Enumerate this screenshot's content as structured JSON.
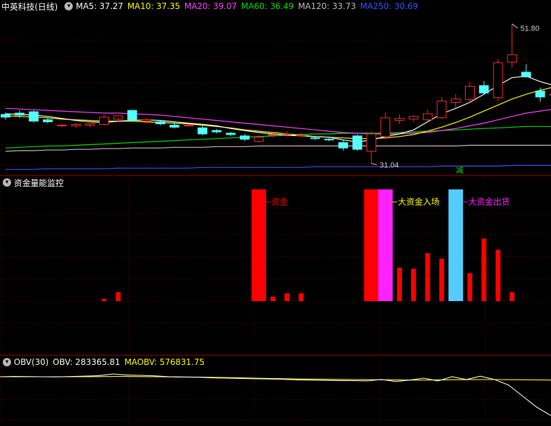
{
  "colors": {
    "up": "#ff2b2b",
    "down": "#54ffff",
    "grid": "#7a0000",
    "ma5": "#ffffff",
    "ma10": "#ffff00",
    "ma20": "#ff44ff",
    "ma60": "#00e000",
    "ma120": "#bfbfbf",
    "ma250": "#3355ff",
    "fund_red": "#ff0000",
    "fund_magenta": "#ff22ff",
    "fund_blue": "#55ccff",
    "obv": "#ffffff",
    "maobv": "#ffff00",
    "jian": "#00e000"
  },
  "main_panel": {
    "title": "中英科技(日线)",
    "indicators": [
      {
        "label": "MA5: 37.27",
        "color": "#ffffff"
      },
      {
        "label": "MA10: 37.35",
        "color": "#ffff00"
      },
      {
        "label": "MA20: 39.07",
        "color": "#ff44ff"
      },
      {
        "label": "MA60: 36.49",
        "color": "#00e000"
      },
      {
        "label": "MA120: 33.73",
        "color": "#bfbfbf"
      },
      {
        "label": "MA250: 30.69",
        "color": "#3355ff"
      }
    ],
    "high_label": "51.80",
    "low_label": "31.04",
    "marker_text": "减"
  },
  "fund_panel": {
    "title": "资金量能监控",
    "labels": [
      {
        "text": "资金",
        "color": "#ff0000"
      },
      {
        "text": "大资金入场",
        "color": "#ffff00"
      },
      {
        "text": "大资金出货",
        "color": "#ff22ff"
      }
    ]
  },
  "obv_panel": {
    "title": "OBV(30)",
    "obv_label": "OBV: 283365.81",
    "maobv_label": "MAOBV: 576831.75"
  },
  "chart_data": [
    {
      "type": "candlestick",
      "name": "中英科技(日线)",
      "price_range": [
        29.5,
        53.5
      ],
      "candles": [
        {
          "o": 38.3,
          "h": 38.6,
          "l": 37.5,
          "c": 37.9
        },
        {
          "o": 38.5,
          "h": 38.9,
          "l": 37.8,
          "c": 38.2
        },
        {
          "o": 38.7,
          "h": 38.9,
          "l": 37.1,
          "c": 37.3
        },
        {
          "o": 37.5,
          "h": 37.8,
          "l": 37.0,
          "c": 37.2
        },
        {
          "o": 36.6,
          "h": 36.9,
          "l": 36.4,
          "c": 36.7
        },
        {
          "o": 36.6,
          "h": 37.0,
          "l": 36.3,
          "c": 36.8
        },
        {
          "o": 36.7,
          "h": 37.0,
          "l": 36.4,
          "c": 36.9
        },
        {
          "o": 36.8,
          "h": 38.3,
          "l": 36.7,
          "c": 37.9
        },
        {
          "o": 37.6,
          "h": 38.0,
          "l": 37.2,
          "c": 38.1
        },
        {
          "o": 38.9,
          "h": 39.0,
          "l": 37.3,
          "c": 37.4
        },
        {
          "o": 37.3,
          "h": 37.8,
          "l": 37.0,
          "c": 37.5
        },
        {
          "o": 37.2,
          "h": 37.4,
          "l": 36.7,
          "c": 36.9
        },
        {
          "o": 36.7,
          "h": 37.1,
          "l": 36.2,
          "c": 36.4
        },
        {
          "o": 36.6,
          "h": 36.9,
          "l": 36.4,
          "c": 36.7
        },
        {
          "o": 36.3,
          "h": 36.6,
          "l": 35.2,
          "c": 35.4
        },
        {
          "o": 35.9,
          "h": 36.1,
          "l": 35.5,
          "c": 35.7
        },
        {
          "o": 35.5,
          "h": 35.7,
          "l": 35.1,
          "c": 35.3
        },
        {
          "o": 35.1,
          "h": 35.4,
          "l": 34.3,
          "c": 34.6
        },
        {
          "o": 34.3,
          "h": 35.2,
          "l": 34.1,
          "c": 34.9
        },
        {
          "o": 35.2,
          "h": 35.5,
          "l": 34.9,
          "c": 35.3
        },
        {
          "o": 35.3,
          "h": 35.8,
          "l": 35.0,
          "c": 35.4
        },
        {
          "o": 35.1,
          "h": 35.6,
          "l": 34.9,
          "c": 35.2
        },
        {
          "o": 34.8,
          "h": 35.1,
          "l": 34.5,
          "c": 34.7
        },
        {
          "o": 34.6,
          "h": 34.8,
          "l": 34.3,
          "c": 34.5
        },
        {
          "o": 34.1,
          "h": 34.5,
          "l": 32.9,
          "c": 33.3
        },
        {
          "o": 35.1,
          "h": 35.3,
          "l": 32.9,
          "c": 33.1
        },
        {
          "o": 32.8,
          "h": 35.8,
          "l": 31.0,
          "c": 35.4
        },
        {
          "o": 35.0,
          "h": 38.6,
          "l": 34.6,
          "c": 37.8
        },
        {
          "o": 37.4,
          "h": 38.3,
          "l": 36.9,
          "c": 37.7
        },
        {
          "o": 37.6,
          "h": 38.2,
          "l": 37.2,
          "c": 38.0
        },
        {
          "o": 37.5,
          "h": 39.0,
          "l": 37.3,
          "c": 38.4
        },
        {
          "o": 37.8,
          "h": 40.9,
          "l": 37.6,
          "c": 40.3
        },
        {
          "o": 40.1,
          "h": 41.3,
          "l": 39.3,
          "c": 40.6
        },
        {
          "o": 40.5,
          "h": 43.1,
          "l": 40.1,
          "c": 42.5
        },
        {
          "o": 42.6,
          "h": 43.3,
          "l": 41.2,
          "c": 41.5
        },
        {
          "o": 40.8,
          "h": 46.6,
          "l": 40.3,
          "c": 46.0
        },
        {
          "o": 46.1,
          "h": 51.8,
          "l": 45.3,
          "c": 47.2
        },
        {
          "o": 44.6,
          "h": 45.8,
          "l": 43.8,
          "c": 43.9
        },
        {
          "o": 41.8,
          "h": 42.3,
          "l": 40.2,
          "c": 40.9
        },
        {
          "o": 41.3,
          "h": 41.9,
          "l": 40.1,
          "c": 41.3
        }
      ],
      "ma5": [
        38.4,
        38.3,
        38.2,
        38.0,
        37.7,
        37.4,
        37.2,
        37.1,
        37.3,
        37.4,
        37.5,
        37.4,
        37.2,
        37.0,
        36.8,
        36.6,
        36.2,
        35.9,
        35.6,
        35.4,
        35.2,
        35.1,
        35.0,
        34.9,
        34.5,
        34.2,
        34.5,
        35.0,
        35.4,
        36.0,
        37.2,
        38.4,
        39.2,
        40.1,
        41.3,
        42.6,
        43.8,
        44.0,
        43.2,
        42.6
      ],
      "ma10": [
        38.1,
        38.0,
        37.9,
        37.8,
        37.6,
        37.5,
        37.4,
        37.3,
        37.3,
        37.3,
        37.2,
        37.1,
        37.0,
        36.9,
        36.7,
        36.5,
        36.3,
        36.0,
        35.8,
        35.6,
        35.4,
        35.2,
        35.0,
        34.9,
        34.8,
        34.7,
        34.7,
        34.8,
        35.0,
        35.3,
        35.8,
        36.4,
        37.1,
        37.9,
        38.8,
        39.7,
        40.6,
        41.3,
        41.9,
        42.4
      ],
      "ma20": [
        39.2,
        39.1,
        39.0,
        38.9,
        38.8,
        38.7,
        38.6,
        38.5,
        38.5,
        38.4,
        38.3,
        38.2,
        38.0,
        37.8,
        37.6,
        37.4,
        37.2,
        37.0,
        36.8,
        36.6,
        36.4,
        36.2,
        36.0,
        35.8,
        35.6,
        35.5,
        35.4,
        35.4,
        35.4,
        35.5,
        35.6,
        35.9,
        36.2,
        36.6,
        37.0,
        37.5,
        38.0,
        38.5,
        38.8,
        39.1
      ],
      "ma60": [
        33.3,
        33.4,
        33.5,
        33.6,
        33.6,
        33.7,
        33.8,
        33.9,
        34.0,
        34.1,
        34.2,
        34.3,
        34.4,
        34.5,
        34.6,
        34.7,
        34.8,
        34.9,
        35.0,
        35.1,
        35.2,
        35.3,
        35.4,
        35.4,
        35.5,
        35.5,
        35.5,
        35.5,
        35.6,
        35.7,
        35.8,
        35.9,
        36.0,
        36.1,
        36.2,
        36.3,
        36.4,
        36.5,
        36.5,
        36.5
      ],
      "ma120": [
        32.8,
        32.9,
        32.9,
        33.0,
        33.0,
        33.1,
        33.1,
        33.2,
        33.2,
        33.3,
        33.3,
        33.3,
        33.4,
        33.4,
        33.4,
        33.5,
        33.5,
        33.5,
        33.6,
        33.6,
        33.6,
        33.6,
        33.6,
        33.6,
        33.6,
        33.6,
        33.6,
        33.6,
        33.6,
        33.6,
        33.6,
        33.6,
        33.6,
        33.7,
        33.7,
        33.7,
        33.7,
        33.7,
        33.7,
        33.7
      ],
      "ma250": [
        30.1,
        30.1,
        30.1,
        30.2,
        30.2,
        30.2,
        30.2,
        30.2,
        30.3,
        30.3,
        30.3,
        30.3,
        30.3,
        30.3,
        30.4,
        30.4,
        30.4,
        30.4,
        30.4,
        30.4,
        30.4,
        30.4,
        30.5,
        30.5,
        30.5,
        30.5,
        30.5,
        30.5,
        30.5,
        30.5,
        30.5,
        30.6,
        30.6,
        30.6,
        30.6,
        30.6,
        30.7,
        30.7,
        30.7,
        30.7
      ]
    },
    {
      "type": "bar",
      "name": "资金量能监控",
      "ylim": [
        0,
        100
      ],
      "bars": [
        {
          "i": 7,
          "v": 2,
          "kind": "red"
        },
        {
          "i": 8,
          "v": 8,
          "kind": "red"
        },
        {
          "i": 18,
          "v": 100,
          "kind": "red"
        },
        {
          "i": 19,
          "v": 4,
          "kind": "red"
        },
        {
          "i": 20,
          "v": 7,
          "kind": "red"
        },
        {
          "i": 21,
          "v": 7,
          "kind": "red"
        },
        {
          "i": 26,
          "v": 100,
          "kind": "red"
        },
        {
          "i": 27,
          "v": 100,
          "kind": "magenta"
        },
        {
          "i": 28,
          "v": 30,
          "kind": "red"
        },
        {
          "i": 29,
          "v": 29,
          "kind": "red"
        },
        {
          "i": 30,
          "v": 43,
          "kind": "red"
        },
        {
          "i": 31,
          "v": 38,
          "kind": "red"
        },
        {
          "i": 32,
          "v": 100,
          "kind": "blue"
        },
        {
          "i": 33,
          "v": 25,
          "kind": "red"
        },
        {
          "i": 34,
          "v": 56,
          "kind": "red"
        },
        {
          "i": 35,
          "v": 46,
          "kind": "red"
        },
        {
          "i": 36,
          "v": 8,
          "kind": "red"
        }
      ]
    },
    {
      "type": "line",
      "name": "OBV(30)",
      "ylim": [
        -700000,
        1200000
      ],
      "series": [
        {
          "name": "OBV",
          "values": [
            1000000,
            1010000,
            1005000,
            1000000,
            995000,
            1008000,
            1020000,
            1040000,
            1100000,
            1060000,
            1050000,
            1030000,
            1000000,
            990000,
            985000,
            960000,
            950000,
            940000,
            930000,
            920000,
            910000,
            890000,
            880000,
            870000,
            860000,
            860000,
            850000,
            900000,
            830000,
            880000,
            950000,
            850000,
            1000000,
            900000,
            1020000,
            900000,
            700000,
            300000,
            -100000,
            -400000
          ]
        },
        {
          "name": "MAOBV",
          "values": [
            1000000,
            1000000,
            1000000,
            1000000,
            1000000,
            1000000,
            1000000,
            1005000,
            1010000,
            1010000,
            1005000,
            1000000,
            995000,
            990000,
            985000,
            980000,
            970000,
            960000,
            950000,
            940000,
            930000,
            920000,
            915000,
            910000,
            905000,
            900000,
            895000,
            890000,
            885000,
            880000,
            880000,
            885000,
            890000,
            895000,
            900000,
            900000,
            895000,
            890000,
            885000,
            880000
          ]
        }
      ]
    }
  ]
}
